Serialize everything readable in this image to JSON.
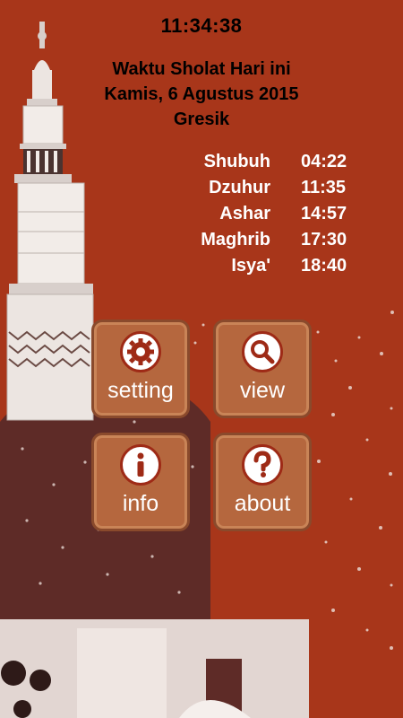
{
  "status": {
    "time": "11:34:38"
  },
  "header": {
    "line1": "Waktu Sholat Hari ini",
    "line2": "Kamis, 6 Agustus 2015",
    "city": "Gresik"
  },
  "prayers": [
    {
      "name": "Shubuh",
      "time": "04:22"
    },
    {
      "name": "Dzuhur",
      "time": "11:35"
    },
    {
      "name": "Ashar",
      "time": "14:57"
    },
    {
      "name": "Maghrib",
      "time": "17:30"
    },
    {
      "name": "Isya'",
      "time": "18:40"
    }
  ],
  "menu": {
    "setting": {
      "label": "setting",
      "icon": "gear-icon"
    },
    "view": {
      "label": "view",
      "icon": "search-icon"
    },
    "info": {
      "label": "info",
      "icon": "info-icon"
    },
    "about": {
      "label": "about",
      "icon": "question-icon"
    }
  },
  "colors": {
    "background": "#a8361a",
    "dome": "#5e2b27",
    "tile": "#b5673e",
    "tile_border": "#8a4a2c",
    "icon_ring": "#9e2a16"
  }
}
